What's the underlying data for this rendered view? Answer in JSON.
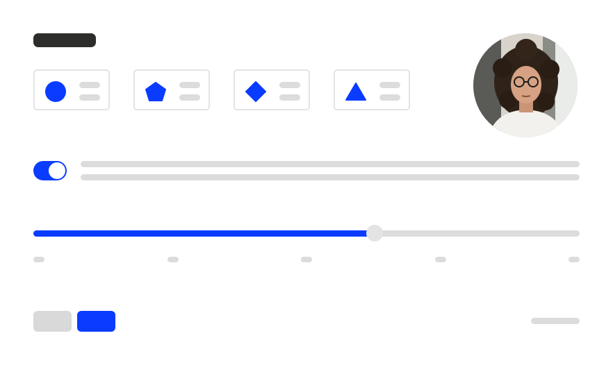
{
  "colors": {
    "accent": "#0a3cff",
    "placeholder": "#dcdcdc",
    "border": "#e3e3e3",
    "title_pill": "#2d2d2b"
  },
  "option_cards": [
    {
      "icon": "circle-icon"
    },
    {
      "icon": "pentagon-icon"
    },
    {
      "icon": "diamond-icon"
    },
    {
      "icon": "triangle-icon"
    }
  ],
  "toggle": {
    "on": true
  },
  "slider": {
    "value_fraction": 0.625,
    "tick_count": 5
  },
  "buttons": {
    "secondary": "",
    "primary": ""
  }
}
